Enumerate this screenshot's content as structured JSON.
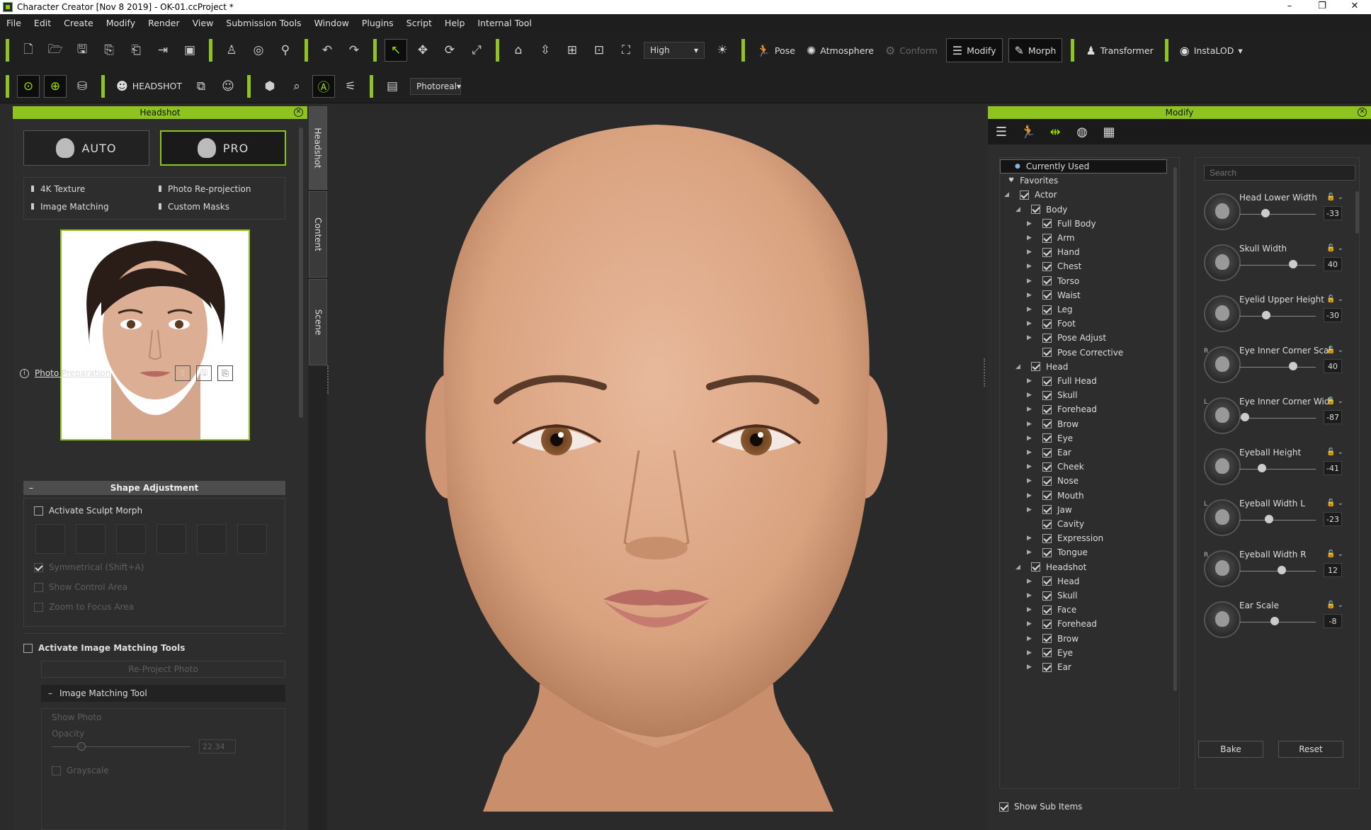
{
  "window": {
    "title": "Character Creator [Nov  8 2019] - OK-01.ccProject *",
    "minimize": "–",
    "maximize": "❐",
    "close": "✕"
  },
  "menu": [
    "File",
    "Edit",
    "Create",
    "Modify",
    "Render",
    "View",
    "Submission Tools",
    "Window",
    "Plugins",
    "Script",
    "Help",
    "Internal Tool"
  ],
  "toolbar1": {
    "quality": "High",
    "pose": "Pose",
    "atmosphere": "Atmosphere",
    "conform": "Conform",
    "modify": "Modify",
    "morph": "Morph",
    "transformer": "Transformer",
    "instalod": "InstaLOD"
  },
  "toolbar2": {
    "headshot": "HEADSHOT",
    "render_mode": "Photoreal"
  },
  "left_panel": {
    "title": "Headshot",
    "auto": "AUTO",
    "pro": "PRO",
    "features": [
      "4K Texture",
      "Photo Re-projection",
      "Image Matching",
      "Custom Masks"
    ],
    "photo_prep": "Photo Preparation",
    "shape_adjustment": "Shape Adjustment",
    "activate_sculpt": "Activate Sculpt Morph",
    "symmetrical": "Symmetrical (Shift+A)",
    "show_control": "Show Control Area",
    "zoom_focus": "Zoom to Focus Area",
    "activate_image_matching": "Activate Image Matching Tools",
    "reproject": "Re-Project Photo",
    "image_matching_tool": "Image Matching Tool",
    "show_photo": "Show Photo",
    "opacity": "Opacity",
    "opacity_value": "22.34",
    "grayscale": "Grayscale"
  },
  "side_tabs": [
    "Headshot",
    "Content",
    "Scene"
  ],
  "right_panel": {
    "title": "Modify",
    "search_placeholder": "Search",
    "tree": [
      {
        "label": "Currently Used",
        "level": 0,
        "kind": "dot"
      },
      {
        "label": "Favorites",
        "level": 0,
        "kind": "heart"
      },
      {
        "label": "Actor",
        "level": 0,
        "kind": "open"
      },
      {
        "label": "Body",
        "level": 1,
        "kind": "open"
      },
      {
        "label": "Full Body",
        "level": 2,
        "kind": "closed"
      },
      {
        "label": "Arm",
        "level": 2,
        "kind": "closed"
      },
      {
        "label": "Hand",
        "level": 2,
        "kind": "closed"
      },
      {
        "label": "Chest",
        "level": 2,
        "kind": "closed"
      },
      {
        "label": "Torso",
        "level": 2,
        "kind": "closed"
      },
      {
        "label": "Waist",
        "level": 2,
        "kind": "closed"
      },
      {
        "label": "Leg",
        "level": 2,
        "kind": "closed"
      },
      {
        "label": "Foot",
        "level": 2,
        "kind": "closed"
      },
      {
        "label": "Pose Adjust",
        "level": 2,
        "kind": "closed"
      },
      {
        "label": "Pose Corrective",
        "level": 2,
        "kind": "leaf"
      },
      {
        "label": "Head",
        "level": 1,
        "kind": "open"
      },
      {
        "label": "Full Head",
        "level": 2,
        "kind": "closed"
      },
      {
        "label": "Skull",
        "level": 2,
        "kind": "closed"
      },
      {
        "label": "Forehead",
        "level": 2,
        "kind": "closed"
      },
      {
        "label": "Brow",
        "level": 2,
        "kind": "closed"
      },
      {
        "label": "Eye",
        "level": 2,
        "kind": "closed"
      },
      {
        "label": "Ear",
        "level": 2,
        "kind": "closed"
      },
      {
        "label": "Cheek",
        "level": 2,
        "kind": "closed"
      },
      {
        "label": "Nose",
        "level": 2,
        "kind": "closed"
      },
      {
        "label": "Mouth",
        "level": 2,
        "kind": "closed"
      },
      {
        "label": "Jaw",
        "level": 2,
        "kind": "closed"
      },
      {
        "label": "Cavity",
        "level": 2,
        "kind": "leaf"
      },
      {
        "label": "Expression",
        "level": 2,
        "kind": "closed"
      },
      {
        "label": "Tongue",
        "level": 2,
        "kind": "closed"
      },
      {
        "label": "Headshot",
        "level": 1,
        "kind": "open"
      },
      {
        "label": "Head",
        "level": 2,
        "kind": "closed"
      },
      {
        "label": "Skull",
        "level": 2,
        "kind": "closed"
      },
      {
        "label": "Face",
        "level": 2,
        "kind": "closed"
      },
      {
        "label": "Forehead",
        "level": 2,
        "kind": "closed"
      },
      {
        "label": "Brow",
        "level": 2,
        "kind": "closed"
      },
      {
        "label": "Eye",
        "level": 2,
        "kind": "closed"
      },
      {
        "label": "Ear",
        "level": 2,
        "kind": "closed"
      }
    ],
    "sliders": [
      {
        "label": "Head Lower Width",
        "prefix": "",
        "value": "-33",
        "level": 0.34
      },
      {
        "label": "Skull Width",
        "prefix": "",
        "value": "40",
        "level": 0.7
      },
      {
        "label": "Eyelid Upper Height",
        "prefix": "",
        "value": "-30",
        "level": 0.35
      },
      {
        "label": "Eye Inner Corner Scal",
        "prefix": "R",
        "value": "40",
        "level": 0.7
      },
      {
        "label": "Eye Inner Corner Widtl",
        "prefix": "L",
        "value": "-87",
        "level": 0.07
      },
      {
        "label": "Eyeball Height",
        "prefix": "",
        "value": "-41",
        "level": 0.3
      },
      {
        "label": "Eyeball Width L",
        "prefix": "L",
        "value": "-23",
        "level": 0.39
      },
      {
        "label": "Eyeball Width R",
        "prefix": "R",
        "value": "12",
        "level": 0.56
      },
      {
        "label": "Ear Scale",
        "prefix": "",
        "value": "-8",
        "level": 0.46
      }
    ],
    "bake": "Bake",
    "reset": "Reset",
    "show_sub_items": "Show Sub Items"
  }
}
